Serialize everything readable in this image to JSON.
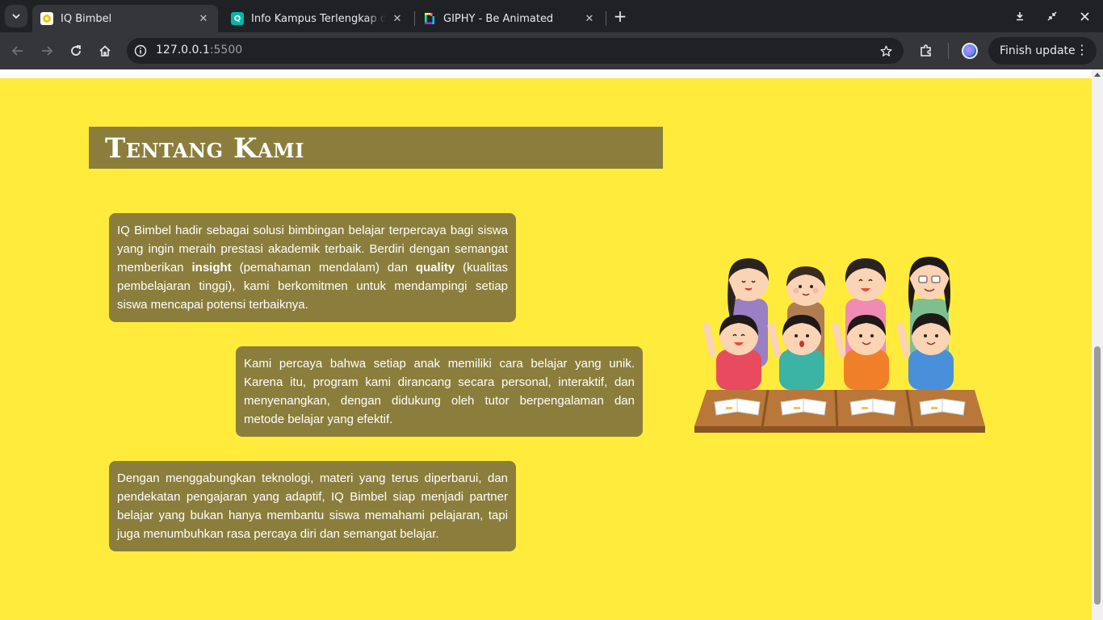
{
  "browser": {
    "tabs": [
      {
        "title": "IQ Bimbel",
        "favicon": "iq-bimbel-favicon",
        "active": true
      },
      {
        "title": "Info Kampus Terlengkap dan",
        "favicon": "quipper-q-favicon",
        "active": false
      },
      {
        "title": "GIPHY - Be Animated",
        "favicon": "giphy-favicon",
        "active": false
      }
    ],
    "url_host": "127.0.0.1",
    "url_port": ":5500",
    "finish_update": "Finish update"
  },
  "page": {
    "heading": "Tentang Kami",
    "card1": {
      "t1": "IQ Bimbel hadir sebagai solusi bimbingan belajar terpercaya bagi siswa yang ingin meraih prestasi akademik terbaik. Berdiri dengan semangat memberikan ",
      "b1": "insight",
      "t2": " (pemahaman mendalam) dan ",
      "b2": "quality",
      "t3": " (kualitas pembelajaran tinggi), kami berkomitmen untuk mendampingi setiap siswa mencapai potensi terbaiknya."
    },
    "card2": "Kami percaya bahwa setiap anak memiliki cara belajar yang unik. Karena itu, program kami dirancang secara personal, interaktif, dan menyenangkan, dengan didukung oleh tutor berpengalaman dan metode belajar yang efektif.",
    "card3": "Dengan menggabungkan teknologi, materi yang terus diperbarui, dan pendekatan pengajaran yang adaptif, IQ Bimbel siap menjadi partner belajar yang bukan hanya membantu siswa memahami pelajaran, tapi juga menumbuhkan rasa percaya diri dan semangat belajar."
  },
  "colors": {
    "page_bg": "#ffeb3b",
    "box_bg": "#8b7e3c",
    "text": "#ffffff"
  }
}
